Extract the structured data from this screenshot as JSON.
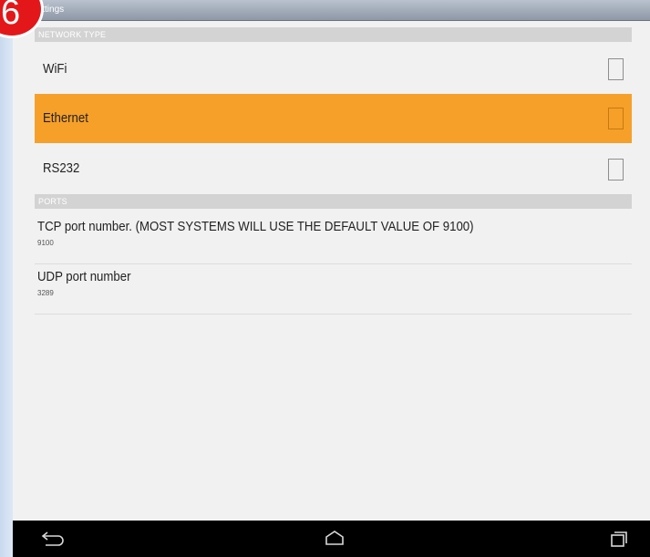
{
  "app": {
    "title": "Settings"
  },
  "step_badge": "6",
  "sections": {
    "network_type": {
      "header": "NETWORK TYPE",
      "options": [
        {
          "label": "WiFi",
          "checked": false,
          "selected": false
        },
        {
          "label": "Ethernet",
          "checked": false,
          "selected": true
        },
        {
          "label": "RS232",
          "checked": false,
          "selected": false
        }
      ]
    },
    "ports": {
      "header": "PORTS",
      "items": [
        {
          "title": "TCP port number. (MOST SYSTEMS WILL USE THE DEFAULT VALUE OF 9100)",
          "value": "9100"
        },
        {
          "title": "UDP port number",
          "value": "3289"
        }
      ]
    }
  },
  "navbar": {
    "icons": [
      "back-icon",
      "home-icon",
      "recent-apps-icon"
    ]
  },
  "colors": {
    "accent": "#f6a02a",
    "badge": "#e3171a",
    "navbar": "#000000",
    "section_header": "#d3d3d3"
  }
}
